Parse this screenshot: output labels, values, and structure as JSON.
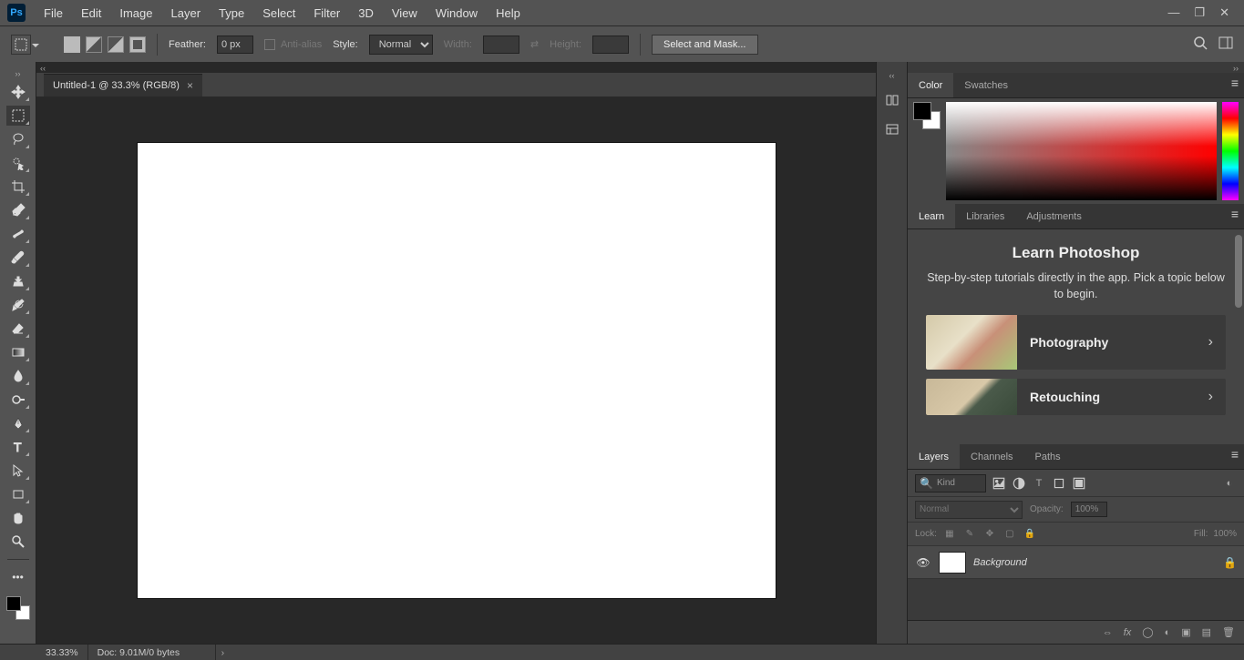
{
  "app": {
    "logo": "Ps"
  },
  "menu": [
    "File",
    "Edit",
    "Image",
    "Layer",
    "Type",
    "Select",
    "Filter",
    "3D",
    "View",
    "Window",
    "Help"
  ],
  "options": {
    "feather_label": "Feather:",
    "feather_value": "0 px",
    "antialias_label": "Anti-alias",
    "style_label": "Style:",
    "style_value": "Normal",
    "width_label": "Width:",
    "height_label": "Height:",
    "select_mask": "Select and Mask..."
  },
  "document": {
    "tab_title": "Untitled-1 @ 33.3% (RGB/8)"
  },
  "panels": {
    "color_tabs": [
      "Color",
      "Swatches"
    ],
    "learn_tabs": [
      "Learn",
      "Libraries",
      "Adjustments"
    ],
    "learn": {
      "title": "Learn Photoshop",
      "subtitle": "Step-by-step tutorials directly in the app. Pick a topic below to begin.",
      "cards": [
        {
          "label": "Photography"
        },
        {
          "label": "Retouching"
        }
      ]
    },
    "layers_tabs": [
      "Layers",
      "Channels",
      "Paths"
    ],
    "layers": {
      "filter_kind": "Kind",
      "blend_mode": "Normal",
      "opacity_label": "Opacity:",
      "opacity_value": "100%",
      "lock_label": "Lock:",
      "fill_label": "Fill:",
      "fill_value": "100%",
      "items": [
        {
          "name": "Background"
        }
      ]
    }
  },
  "status": {
    "zoom": "33.33%",
    "doc_info": "Doc: 9.01M/0 bytes"
  }
}
